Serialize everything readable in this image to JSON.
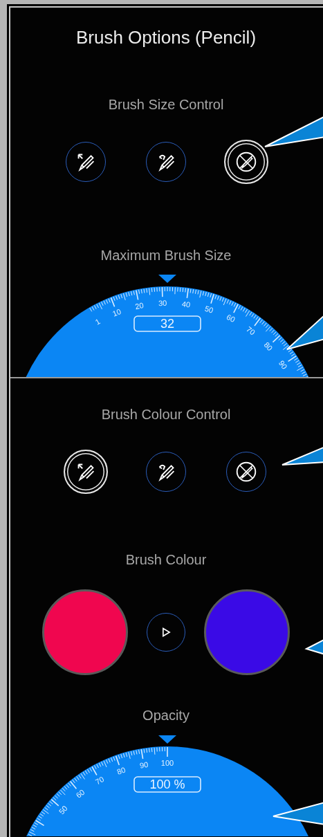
{
  "title": "Brush Options (Pencil)",
  "size_control": {
    "label": "Brush Size Control",
    "modes": [
      {
        "kind": "pressure",
        "selected": false
      },
      {
        "kind": "tilt",
        "selected": false
      },
      {
        "kind": "none",
        "selected": true
      }
    ]
  },
  "max_size": {
    "label": "Maximum Brush Size",
    "reading": "32",
    "scale_labels": [
      "1",
      "10",
      "20",
      "30",
      "40",
      "50",
      "60",
      "70",
      "80",
      "90"
    ]
  },
  "colour_control": {
    "label": "Brush Colour Control",
    "modes": [
      {
        "kind": "pressure",
        "selected": true
      },
      {
        "kind": "tilt",
        "selected": false
      },
      {
        "kind": "none",
        "selected": false
      }
    ]
  },
  "brush_colour": {
    "label": "Brush Colour",
    "swatches": [
      {
        "color": "#f0064f"
      },
      {
        "color": "#3a0ae6"
      }
    ]
  },
  "opacity": {
    "label": "Opacity",
    "reading": "100 %",
    "scale_labels": [
      "50",
      "60",
      "70",
      "80",
      "90",
      "100"
    ]
  }
}
